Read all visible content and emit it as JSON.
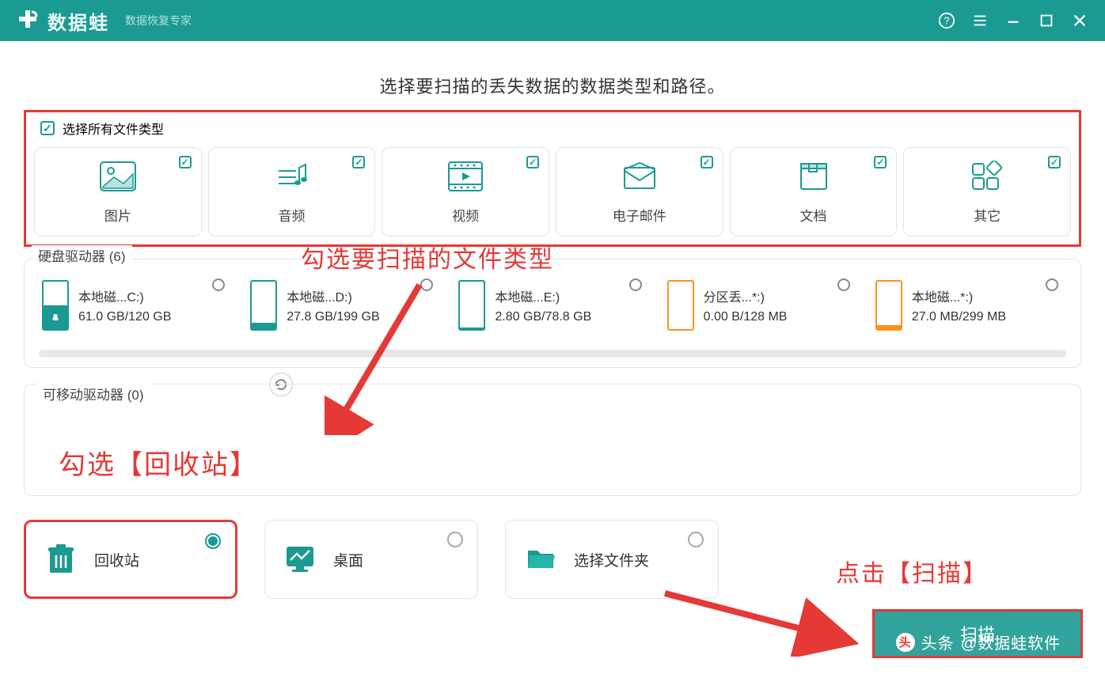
{
  "app": {
    "name": "数据蛙",
    "subtitle": "数据恢复专家"
  },
  "main": {
    "title": "选择要扫描的丢失数据的数据类型和路径。",
    "select_all_label": "选择所有文件类型"
  },
  "filetypes": [
    {
      "label": "图片",
      "checked": true
    },
    {
      "label": "音频",
      "checked": true
    },
    {
      "label": "视频",
      "checked": true
    },
    {
      "label": "电子邮件",
      "checked": true
    },
    {
      "label": "文档",
      "checked": true
    },
    {
      "label": "其它",
      "checked": true
    }
  ],
  "sections": {
    "hard_drives_label": "硬盘驱动器  (6)",
    "removable_label": "可移动驱动器  (0)"
  },
  "drives": [
    {
      "name": "本地磁...C:)",
      "size": "61.0 GB/120 GB",
      "fill": 50,
      "color": "teal",
      "apple": true
    },
    {
      "name": "本地磁...D:)",
      "size": "27.8 GB/199 GB",
      "fill": 14,
      "color": "teal"
    },
    {
      "name": "本地磁...E:)",
      "size": "2.80 GB/78.8 GB",
      "fill": 4,
      "color": "teal"
    },
    {
      "name": "分区丢...*:)",
      "size": "0.00  B/128 MB",
      "fill": 0,
      "color": "orange"
    },
    {
      "name": "本地磁...*:)",
      "size": "27.0 MB/299 MB",
      "fill": 9,
      "color": "orange"
    }
  ],
  "locations": {
    "recycle_bin": "回收站",
    "desktop": "桌面",
    "folder": "选择文件夹"
  },
  "scan_button": "扫描",
  "annotations": {
    "filetype_hint": "勾选要扫描的文件类型",
    "recycle_hint": "勾选【回收站】",
    "scan_hint": "点击【扫描】"
  },
  "watermark": {
    "prefix": "头条",
    "text": "@数据蛙软件"
  }
}
